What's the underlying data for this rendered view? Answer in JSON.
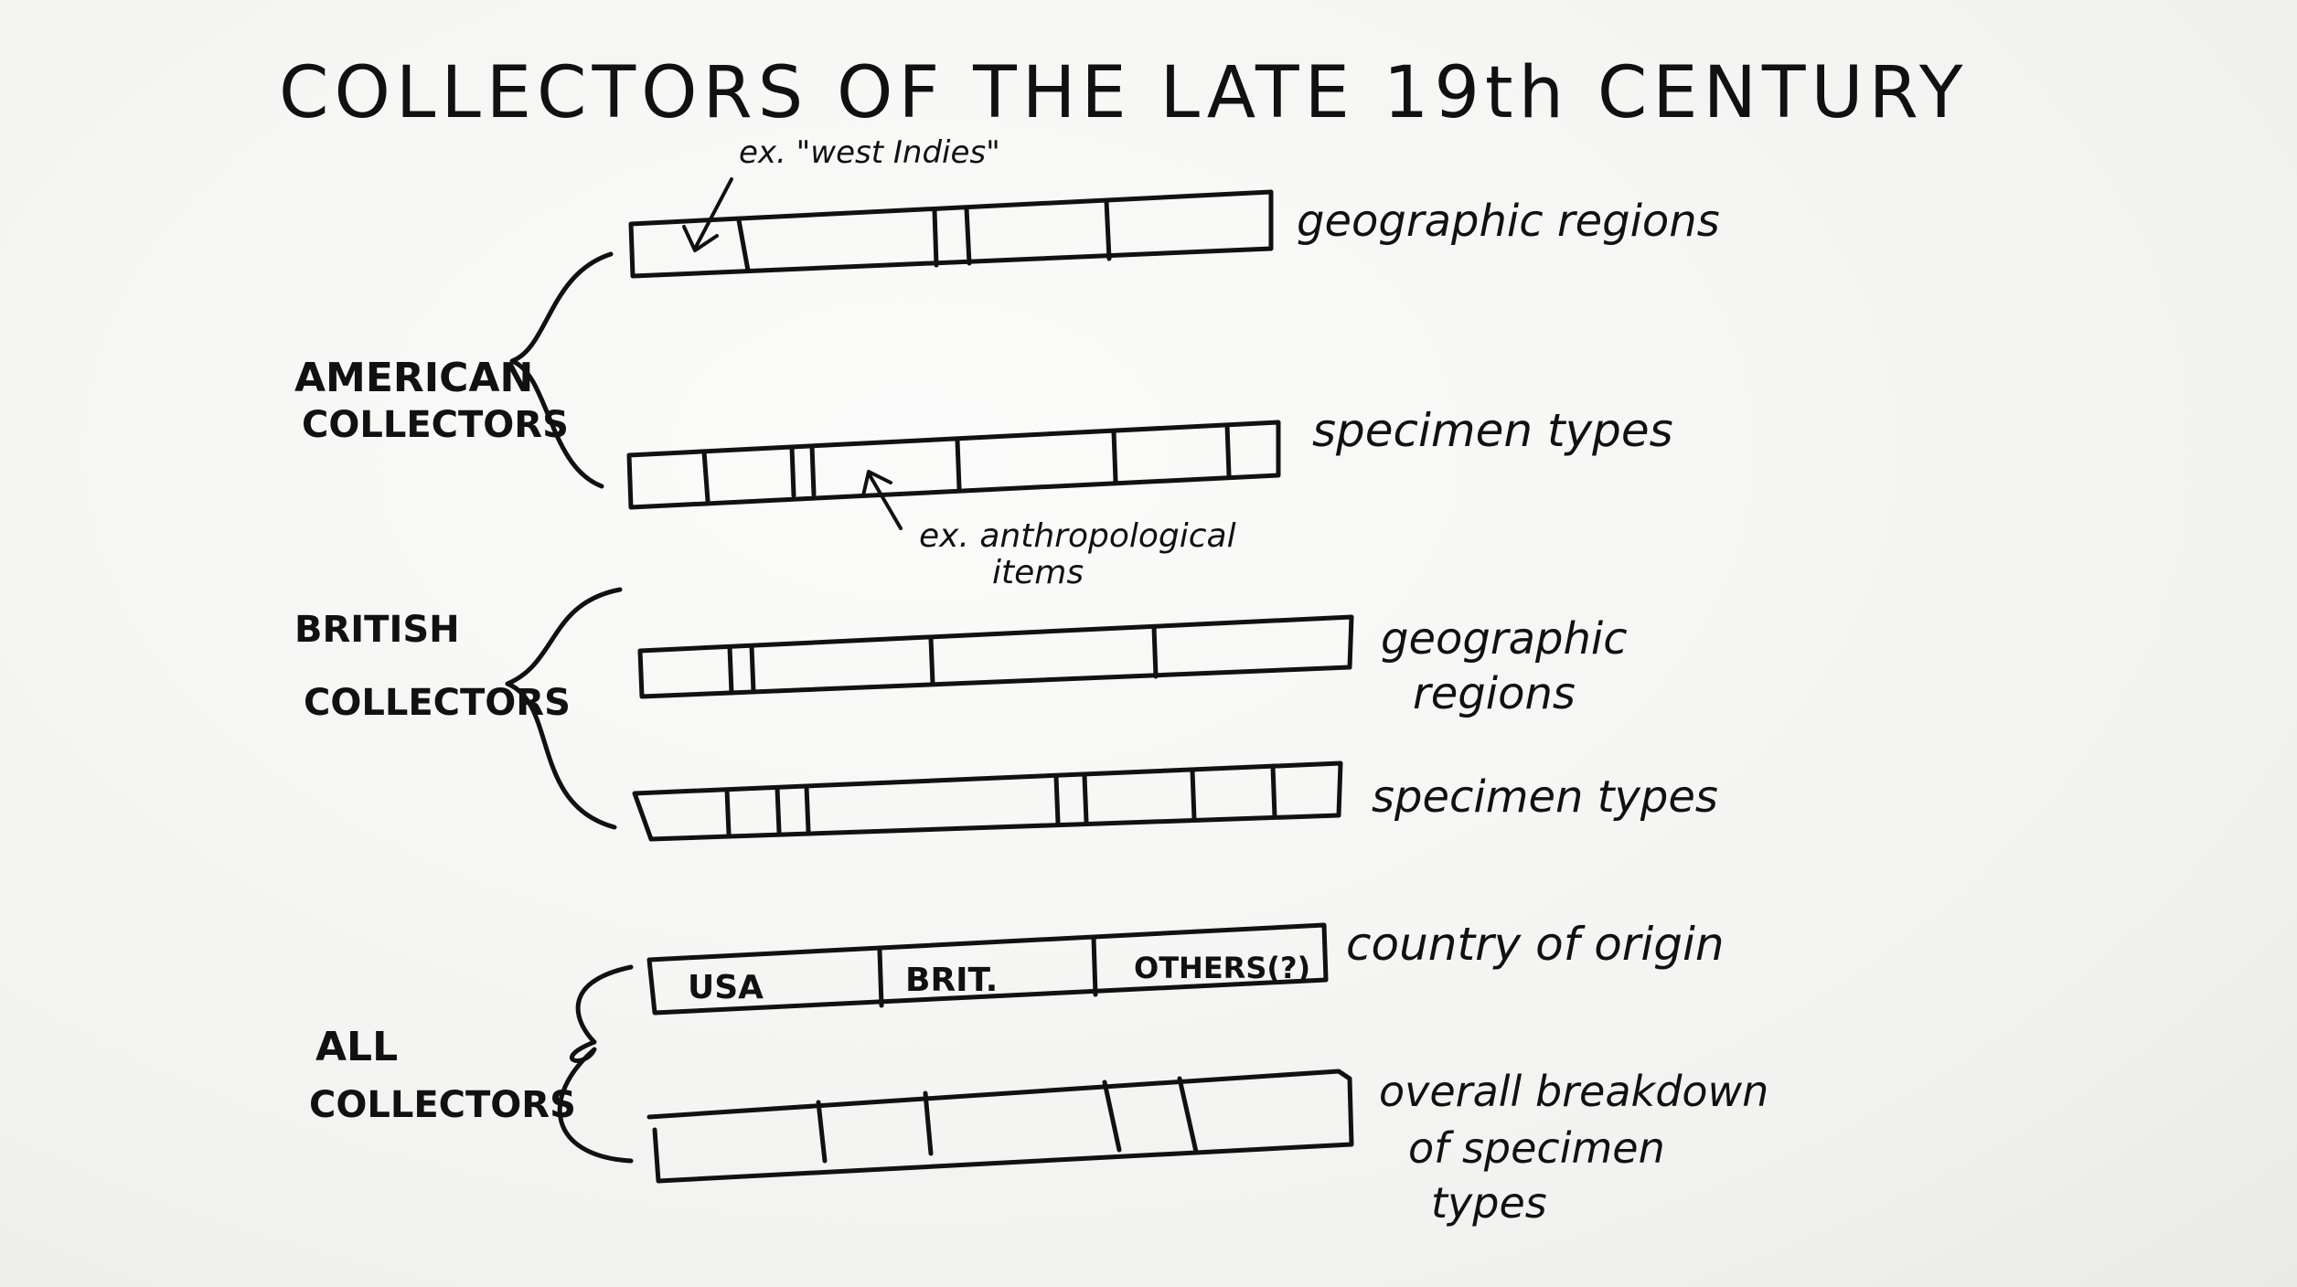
{
  "title": "COLLECTORS OF THE LATE 19th CENTURY",
  "groups": {
    "american": {
      "label_line1": "AMERICAN",
      "label_line2": "COLLECTORS",
      "bar1_label": "geographic regions",
      "bar1_annotation": "ex. \"west Indies\"",
      "bar2_label": "specimen types",
      "bar2_annotation_line1": "ex. anthropological",
      "bar2_annotation_line2": "items"
    },
    "british": {
      "label_line1": "BRITISH",
      "label_line2": "COLLECTORS",
      "bar1_label_line1": "geographic",
      "bar1_label_line2": "regions",
      "bar2_label": "specimen types"
    },
    "all": {
      "label_line1": "ALL",
      "label_line2": "COLLECTORS",
      "bar1_label": "country of origin",
      "bar1_segments": [
        "USA",
        "BRIT.",
        "OTHERS(?)"
      ],
      "bar2_label_line1": "overall breakdown",
      "bar2_label_line2": "of specimen",
      "bar2_label_line3": "types"
    }
  }
}
